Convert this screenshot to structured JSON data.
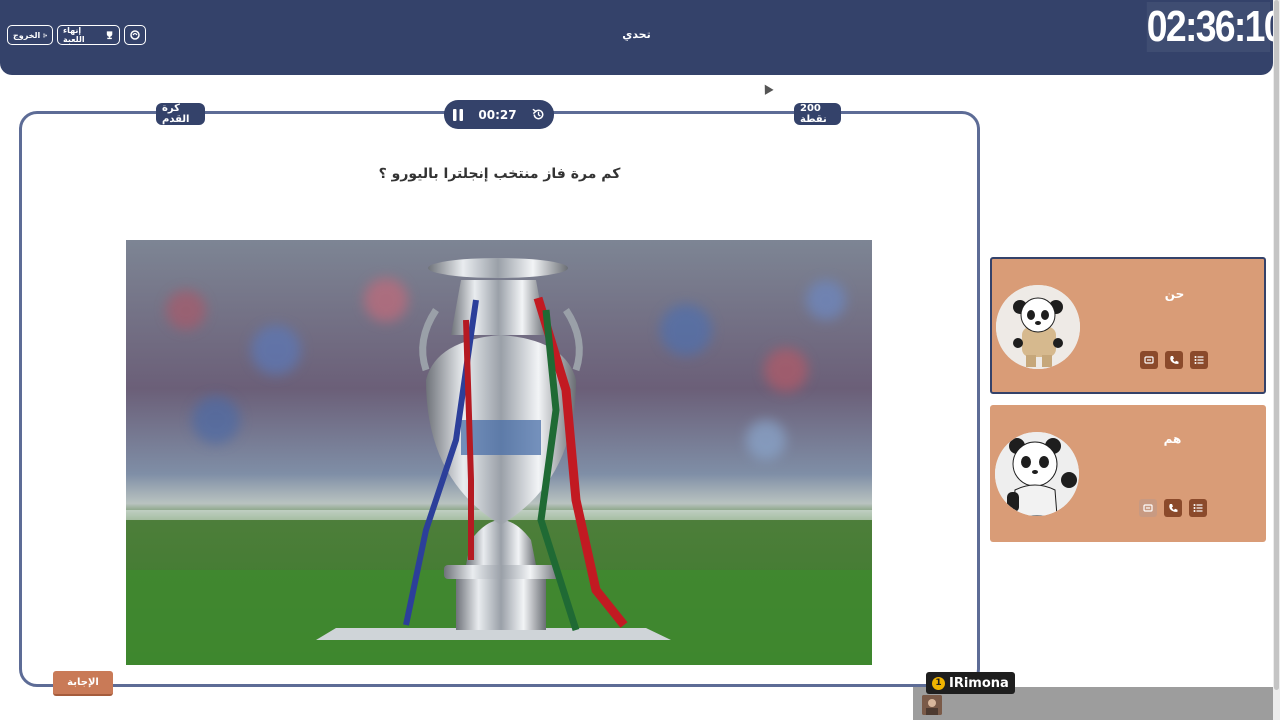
{
  "header": {
    "title": "تحدي",
    "exit_label": "الخروج",
    "end_game_label": "إنهاء اللعبة",
    "clock": "02:36:10"
  },
  "card": {
    "category": "كرة القدم",
    "points": "200 نقطة",
    "timer": "00:27",
    "question": "كم مرة فاز منتخب إنجلترا باليورو ؟",
    "answer_label": "الإجابة"
  },
  "teams": [
    {
      "name": "حن",
      "active": true
    },
    {
      "name": "هم",
      "active": false
    }
  ],
  "streamer": {
    "rank": "1",
    "name": "IRimona"
  },
  "colors": {
    "header_bg": "#34426a",
    "card_border": "#5d6c96",
    "team_bg": "#d99c77",
    "answer_btn": "#c97a57",
    "team_icon": "#8b4a2b"
  },
  "icons": [
    "exit-icon",
    "trophy-icon",
    "hands-icon",
    "pause-icon",
    "history-icon",
    "swap-icon",
    "phone-icon",
    "list-icon"
  ]
}
